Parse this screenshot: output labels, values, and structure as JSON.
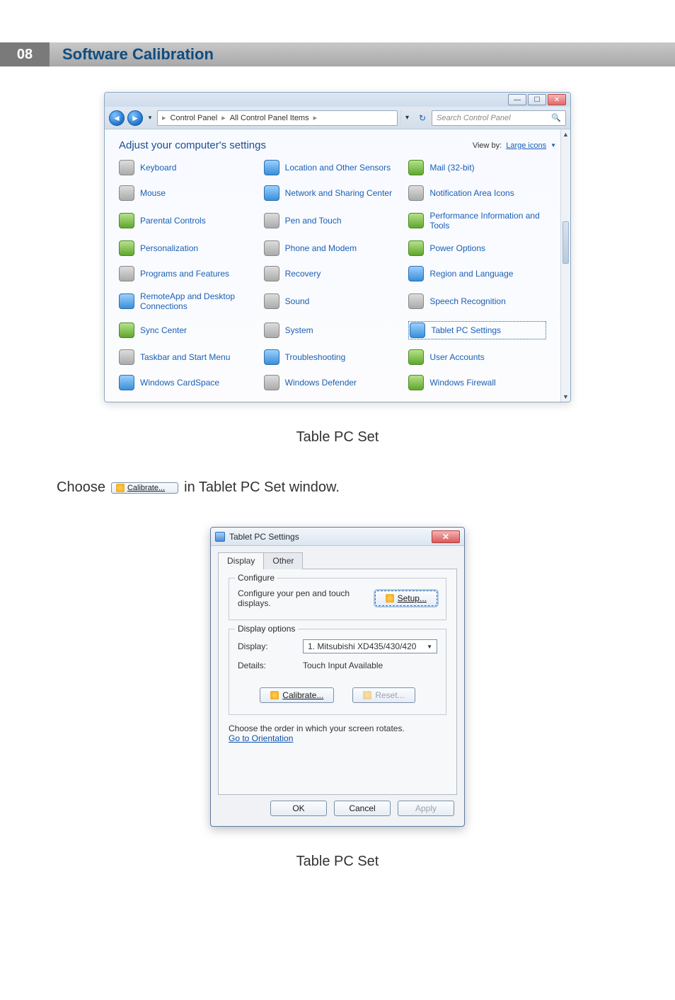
{
  "header": {
    "num": "08",
    "title": "Software Calibration"
  },
  "cp": {
    "crumbs": [
      "Control Panel",
      "All Control Panel Items"
    ],
    "search_placeholder": "Search Control Panel",
    "heading": "Adjust your computer's settings",
    "viewby_label": "View by:",
    "viewby_value": "Large icons",
    "items": [
      "Keyboard",
      "Location and Other Sensors",
      "Mail (32-bit)",
      "Mouse",
      "Network and Sharing Center",
      "Notification Area Icons",
      "Parental Controls",
      "Pen and Touch",
      "Performance Information and Tools",
      "Personalization",
      "Phone and Modem",
      "Power Options",
      "Programs and Features",
      "Recovery",
      "Region and Language",
      "RemoteApp and Desktop Connections",
      "Sound",
      "Speech Recognition",
      "Sync Center",
      "System",
      "Tablet PC Settings",
      "Taskbar and Start Menu",
      "Troubleshooting",
      "User Accounts",
      "Windows CardSpace",
      "Windows Defender",
      "Windows Firewall"
    ],
    "selected_index": 20
  },
  "caption1": "Table PC Set",
  "line": {
    "before": "Choose",
    "btn": "Calibrate...",
    "after": "in Tablet PC Set window."
  },
  "tpc": {
    "title": "Tablet PC Settings",
    "tabs": {
      "t1": "Display",
      "t2": "Other"
    },
    "configure": {
      "legend": "Configure",
      "text": "Configure your pen and touch displays.",
      "setup": "Setup..."
    },
    "display_options": {
      "legend": "Display options",
      "display_label": "Display:",
      "display_value": "1. Mitsubishi XD435/430/420",
      "details_label": "Details:",
      "details_value": "Touch Input Available",
      "calibrate": "Calibrate...",
      "reset": "Reset..."
    },
    "orient_text": "Choose the order in which your screen rotates.",
    "orient_link": "Go to Orientation",
    "buttons": {
      "ok": "OK",
      "cancel": "Cancel",
      "apply": "Apply"
    }
  },
  "caption2": "Table PC Set"
}
